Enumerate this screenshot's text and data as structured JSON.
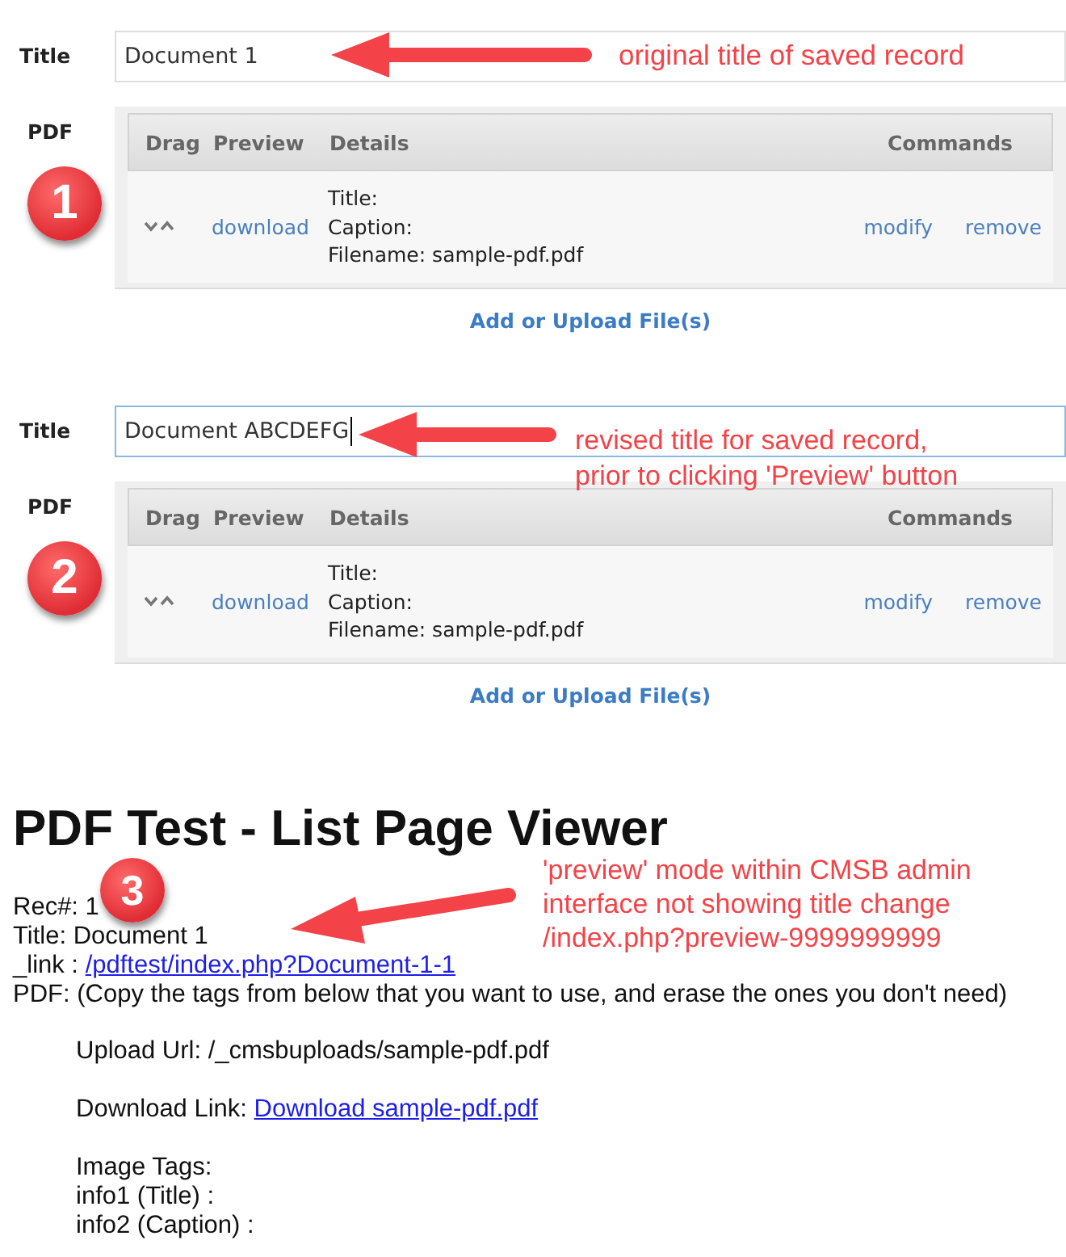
{
  "panels": [
    {
      "badge": "1",
      "title_label": "Title",
      "title_value": "Document 1",
      "focused": false,
      "annotation": [
        "original title of saved record"
      ],
      "pdf_label": "PDF",
      "columns": [
        "Drag",
        "Preview",
        "Details",
        "Commands"
      ],
      "rows": [
        {
          "preview": "download",
          "details": [
            "Title:",
            "Caption:",
            "Filename: sample-pdf.pdf"
          ],
          "commands": [
            "modify",
            "remove"
          ]
        }
      ],
      "add_link": "Add or Upload File(s)"
    },
    {
      "badge": "2",
      "title_label": "Title",
      "title_value": "Document ABCDEFG",
      "focused": true,
      "annotation": [
        "revised title for saved record,",
        "prior to clicking 'Preview' button"
      ],
      "pdf_label": "PDF",
      "columns": [
        "Drag",
        "Preview",
        "Details",
        "Commands"
      ],
      "rows": [
        {
          "preview": "download",
          "details": [
            "Title:",
            "Caption:",
            "Filename: sample-pdf.pdf"
          ],
          "commands": [
            "modify",
            "remove"
          ]
        }
      ],
      "add_link": "Add or Upload File(s)"
    }
  ],
  "viewer": {
    "heading": "PDF Test - List Page Viewer",
    "badge": "3",
    "annotation": [
      "'preview' mode within CMSB admin",
      "interface not showing title change",
      "/index.php?preview-9999999999"
    ],
    "lines": [
      {
        "kind": "text",
        "text": "Rec#: 1"
      },
      {
        "kind": "text",
        "text": "Title: Document 1"
      },
      {
        "kind": "link",
        "label": "_link :",
        "link": "/pdftest/index.php?Document-1-1"
      },
      {
        "kind": "text",
        "text": "PDF: (Copy the tags from below that you want to use, and erase the ones you don't need)"
      }
    ],
    "groups": [
      [
        {
          "kind": "text",
          "text": "Upload Url: /_cmsbuploads/sample-pdf.pdf"
        }
      ],
      [
        {
          "kind": "link",
          "label": "Download Link:",
          "link": "Download sample-pdf.pdf"
        }
      ],
      [
        {
          "kind": "text",
          "text": "Image Tags:"
        },
        {
          "kind": "text",
          "text": "info1 (Title) :"
        },
        {
          "kind": "text",
          "text": "info2 (Caption) :"
        }
      ]
    ]
  }
}
